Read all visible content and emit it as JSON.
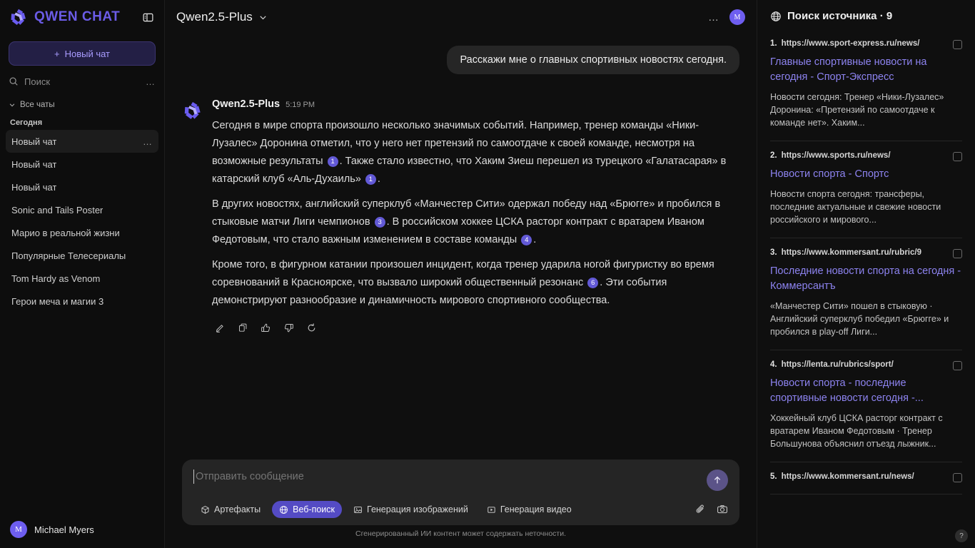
{
  "brand": {
    "name": "QWEN CHAT",
    "logo_icon": "qwen-logo-icon",
    "panel_toggle_icon": "sidebar-toggle-icon"
  },
  "sidebar": {
    "new_chat_label": "Новый чат",
    "plus_icon": "+",
    "search_placeholder": "Поиск",
    "search_icon": "search-icon",
    "search_more_icon": "…",
    "all_chats_label": "Все чаты",
    "chevron_icon": "chevron-down-icon",
    "section_today": "Сегодня",
    "item_dots": "…",
    "chats": [
      {
        "label": "Новый чат",
        "active": true
      },
      {
        "label": "Новый чат",
        "active": false
      },
      {
        "label": "Новый чат",
        "active": false
      },
      {
        "label": "Sonic and Tails Poster",
        "active": false
      },
      {
        "label": "Марио в реальной жизни",
        "active": false
      },
      {
        "label": "Популярные Телесериалы",
        "active": false
      },
      {
        "label": "Tom Hardy as Venom",
        "active": false
      },
      {
        "label": "Герои меча и магии 3",
        "active": false
      }
    ],
    "user": {
      "name": "Michael Myers",
      "initial": "M"
    }
  },
  "topbar": {
    "model": "Qwen2.5-Plus",
    "chevron_icon": "chevron-down-icon",
    "more_icon": "…",
    "avatar_initial": "M"
  },
  "conversation": {
    "user_message": "Расскажи мне о главных спортивных новостях сегодня.",
    "assistant": {
      "name": "Qwen2.5-Plus",
      "time": "5:19 PM",
      "paragraphs": [
        {
          "parts": [
            {
              "t": "text",
              "v": "Сегодня в мире спорта произошло несколько значимых событий. Например, тренер команды «Ники-Лузалес» Доронина отметил, что у него нет претензий по самоотдаче к своей команде, несмотря на возможные результаты "
            },
            {
              "t": "cite",
              "v": "1"
            },
            {
              "t": "text",
              "v": ". Также стало известно, что Хаким Зиеш перешел из турецкого «Галатасарая» в катарский клуб «Аль-Духаиль» "
            },
            {
              "t": "cite",
              "v": "1"
            },
            {
              "t": "text",
              "v": "."
            }
          ]
        },
        {
          "parts": [
            {
              "t": "text",
              "v": "В других новостях, английский суперклуб «Манчестер Сити» одержал победу над «Брюгге» и пробился в стыковые матчи Лиги чемпионов "
            },
            {
              "t": "cite",
              "v": "3"
            },
            {
              "t": "text",
              "v": ". В российском хоккее ЦСКА расторг контракт с вратарем Иваном Федотовым, что стало важным изменением в составе команды "
            },
            {
              "t": "cite",
              "v": "4"
            },
            {
              "t": "text",
              "v": "."
            }
          ]
        },
        {
          "parts": [
            {
              "t": "text",
              "v": "Кроме того, в фигурном катании произошел инцидент, когда тренер ударила ногой фигуристку во время соревнований в Красноярске, что вызвало широкий общественный резонанс "
            },
            {
              "t": "cite",
              "v": "6"
            },
            {
              "t": "text",
              "v": ". Эти события демонстрируют разнообразие и динамичность мирового спортивного сообщества."
            }
          ]
        }
      ],
      "actions": [
        {
          "icon": "edit-pencil-icon"
        },
        {
          "icon": "copy-icon"
        },
        {
          "icon": "thumbs-up-icon"
        },
        {
          "icon": "thumbs-down-icon"
        },
        {
          "icon": "regenerate-icon"
        }
      ]
    }
  },
  "composer": {
    "placeholder": "Отправить сообщение",
    "value": "",
    "send_icon": "arrow-up-icon",
    "attach_icon": "paperclip-icon",
    "camera_icon": "camera-icon",
    "tools": [
      {
        "label": "Артефакты",
        "icon": "cube-icon",
        "active": false
      },
      {
        "label": "Веб-поиск",
        "icon": "globe-icon",
        "active": true
      },
      {
        "label": "Генерация изображений",
        "icon": "image-icon",
        "active": false
      },
      {
        "label": "Генерация видео",
        "icon": "video-icon",
        "active": false
      }
    ],
    "disclaimer": "Сгенерированный ИИ контент может содержать неточности."
  },
  "sources": {
    "icon": "globe-icon",
    "title": "Поиск источника · 9",
    "help_icon": "?",
    "items": [
      {
        "num": "1.",
        "url": "https://www.sport-express.ru/news/",
        "title": "Главные спортивные новости на сегодня - Спорт-Экспресс",
        "snippet": "Новости сегодня: Тренер «Ники-Лузалес» Доронина: «Претензий по самоотдаче к команде нет». Хаким..."
      },
      {
        "num": "2.",
        "url": "https://www.sports.ru/news/",
        "title": "Новости спорта - Спортс",
        "snippet": "Новости спорта сегодня: трансферы, последние актуальные и свежие новости российского и мирового..."
      },
      {
        "num": "3.",
        "url": "https://www.kommersant.ru/rubric/9",
        "title": "Последние новости спорта на сегодня - Коммерсантъ",
        "snippet": "«Манчестер Сити» пошел в стыковую · Английский суперклуб победил «Брюгге» и пробился в play-off Лиги..."
      },
      {
        "num": "4.",
        "url": "https://lenta.ru/rubrics/sport/",
        "title": "Новости спорта - последние спортивные новости сегодня -...",
        "snippet": "Хоккейный клуб ЦСКА расторг контракт с вратарем Иваном Федотовым · Тренер Большунова объяснил отъезд лыжник..."
      },
      {
        "num": "5.",
        "url": "https://www.kommersant.ru/news/",
        "title": "",
        "snippet": ""
      }
    ]
  },
  "colors": {
    "accent": "#6e5ef0",
    "link": "#8d83f0",
    "chip_active": "#544bc4",
    "bg": "#0f0f0f",
    "sidebar_bg": "#0d0d0d"
  }
}
